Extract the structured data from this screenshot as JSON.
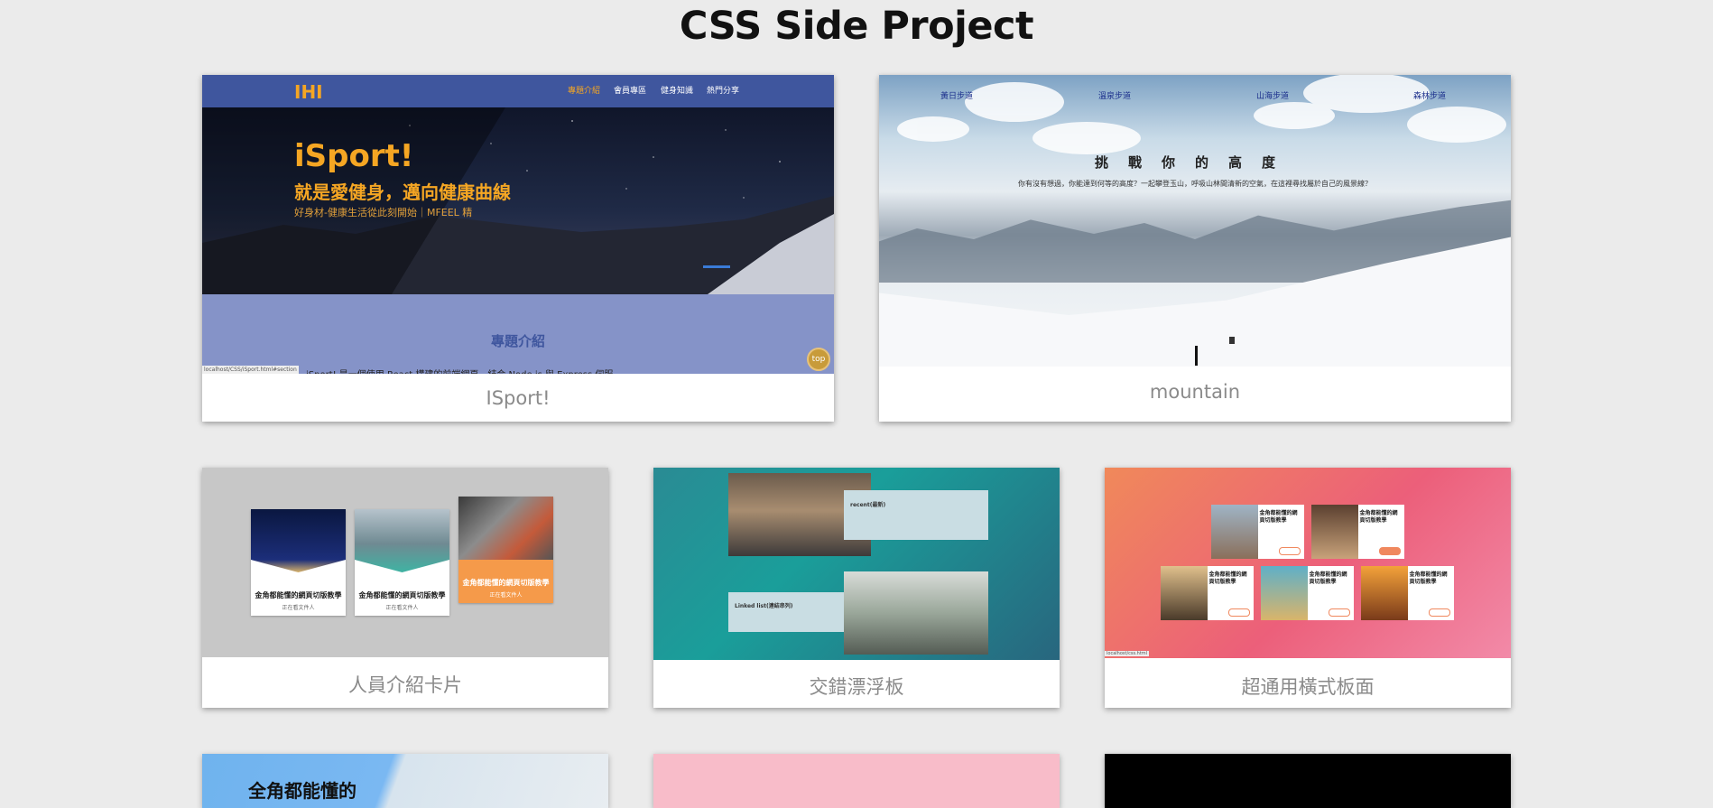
{
  "page": {
    "title": "CSS Side Project"
  },
  "cards": {
    "isport": {
      "caption": "ISport!",
      "logo": "IHI",
      "nav": [
        "專題介紹",
        "會員專區",
        "健身知識",
        "熱門分享"
      ],
      "hero_title": "iSport!",
      "hero_subtitle": "就是愛健身，邁向健康曲線",
      "hero_tagline": "好身材-健康生活從此刻開始｜MFEEL 精",
      "section_title": "專題介紹",
      "section_text": "iSport! 是一個使用 React 構建的前端網頁，結合 Node.js 與 Express 伺服",
      "top_button": "top",
      "status_url": "localhost/CSS/iSport.html#section"
    },
    "mountain": {
      "caption": "mountain",
      "nav": [
        "黃日步道",
        "溫泉步道",
        "山海步道",
        "森林步道"
      ],
      "headline": "挑戰你的高度",
      "subline": "你有沒有想過，你能達到何等的高度？一起攀登玉山，呼吸山林間清新的空氣，在這裡尋找屬於自己的風景線？"
    },
    "people_cards": {
      "caption": "人員介紹卡片",
      "cards": [
        {
          "title": "金角都能懂的網頁切版教學",
          "sub": "正在看文件人"
        },
        {
          "title": "金角都能懂的網頁切版教學",
          "sub": "正在看文件人"
        },
        {
          "title": "金角都能懂的網頁切版教學",
          "sub": "正在看文件人"
        }
      ]
    },
    "floating": {
      "caption": "交錯漂浮板",
      "box1_title": "recent(最新)",
      "box2_title": "Linked list(連結串列)"
    },
    "horizontal": {
      "caption": "超通用橫式板面",
      "card_title": "金角都能懂的網頁切版教學",
      "status_url": "localhost/css.html"
    }
  },
  "colors": {
    "background": "#ebebeb",
    "isport_nav": "#3f569e",
    "isport_accent": "#f5a623",
    "caption": "#8a8a8a"
  }
}
